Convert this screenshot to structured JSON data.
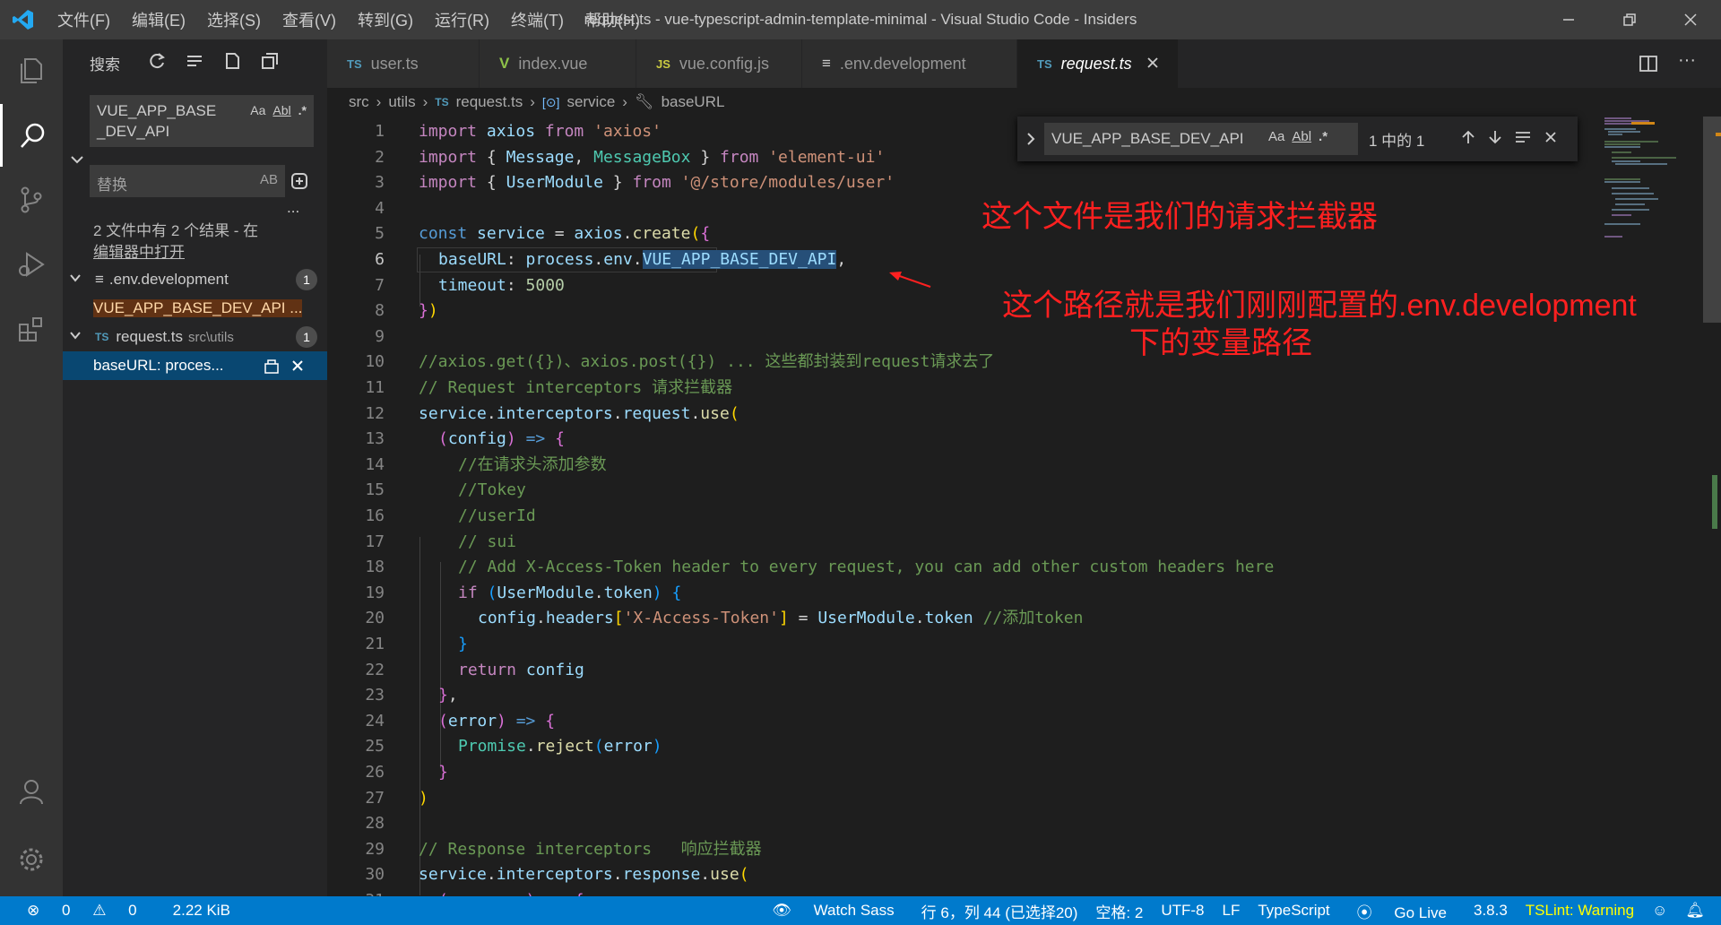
{
  "window": {
    "title": "request.ts - vue-typescript-admin-template-minimal - Visual Studio Code - Insiders",
    "menu": [
      "文件(F)",
      "编辑(E)",
      "选择(S)",
      "查看(V)",
      "转到(G)",
      "运行(R)",
      "终端(T)",
      "帮助(H)"
    ]
  },
  "sidebar": {
    "header": "搜索",
    "search_value_line1": "VUE_APP_BASE",
    "search_value_line2": "_DEV_API",
    "opt_case": "Aa",
    "opt_word": "Abl",
    "opt_regex": ".*",
    "replace_placeholder": "替换",
    "replace_all": "AB",
    "more": "...",
    "result_summary_line1": "2 文件中有 2 个结果 - 在",
    "result_summary_line2": "编辑器中打开",
    "file1": {
      "name": ".env.development",
      "count": "1",
      "match": "VUE_APP_BASE_DEV_API ..."
    },
    "file2": {
      "tag": "TS",
      "name": "request.ts",
      "path": "src\\utils",
      "count": "1",
      "match": "baseURL: proces..."
    }
  },
  "tabs": [
    {
      "tag": "TS",
      "label": "user.ts"
    },
    {
      "tag": "V",
      "label": "index.vue"
    },
    {
      "tag": "JS",
      "label": "vue.config.js"
    },
    {
      "tag": "≡",
      "label": ".env.development"
    },
    {
      "tag": "TS",
      "label": "request.ts"
    }
  ],
  "breadcrumb": [
    "src",
    "utils",
    "TS",
    "request.ts",
    "service",
    "baseURL"
  ],
  "find_widget": {
    "value": "VUE_APP_BASE_DEV_API",
    "opt_case": "Aa",
    "opt_word": "Abl",
    "opt_regex": ".*",
    "result": "1 中的 1"
  },
  "annotations": {
    "a1": "这个文件是我们的请求拦截器",
    "a2_line1": "这个路径就是我们刚刚配置的.env.development",
    "a2_line2": "下的变量路径"
  },
  "code": {
    "l1_a": "import",
    "l1_b": "axios",
    "l1_c": "from",
    "l1_d": "'axios'",
    "l2_a": "import",
    "l2_b": "{",
    "l2_c": "Message",
    "l2_d": "MessageBox",
    "l2_e": "}",
    "l2_f": "from",
    "l2_g": "'element-ui'",
    "l3_a": "import",
    "l3_b": "{",
    "l3_c": "UserModule",
    "l3_d": "}",
    "l3_e": "from",
    "l3_f": "'@/store/modules/user'",
    "l5_a": "const",
    "l5_b": "service",
    "l5_c": "axios",
    "l5_d": "create",
    "l6_a": "baseURL",
    "l6_b": "process",
    "l6_c": "env",
    "l6_d": "VUE_APP_BASE_DEV_API",
    "l7_a": "timeout",
    "l7_b": "5000",
    "l10": "//axios.get({})、axios.post({}) ... 这些都封装到request请求去了",
    "l11": "// Request interceptors 请求拦截器",
    "l12_a": "service",
    "l12_b": "interceptors",
    "l12_c": "request",
    "l12_d": "use",
    "l13": "config",
    "l14": "//在请求头添加参数",
    "l15": "//Tokey",
    "l16": "//userId",
    "l17": "// sui",
    "l18": "// Add X-Access-Token header to every request, you can add other custom headers here",
    "l19_a": "if",
    "l19_b": "UserModule",
    "l19_c": "token",
    "l20_a": "config",
    "l20_b": "headers",
    "l20_c": "'X-Access-Token'",
    "l20_d": "UserModule",
    "l20_e": "token",
    "l20_f": "//添加token",
    "l22_a": "return",
    "l22_b": "config",
    "l24": "error",
    "l25_a": "Promise",
    "l25_b": "reject",
    "l25_c": "error",
    "l29": "// Response interceptors   响应拦截器",
    "l30_a": "service",
    "l30_b": "interceptors",
    "l30_c": "response",
    "l30_d": "use",
    "l31": "response"
  },
  "line_numbers": [
    "1",
    "2",
    "3",
    "4",
    "5",
    "6",
    "7",
    "8",
    "9",
    "10",
    "11",
    "12",
    "13",
    "14",
    "15",
    "16",
    "17",
    "18",
    "19",
    "20",
    "21",
    "22",
    "23",
    "24",
    "25",
    "26",
    "27",
    "28",
    "29",
    "30",
    "31"
  ],
  "statusbar": {
    "errors": "0",
    "warnings": "0",
    "size": "2.22 KiB",
    "watch_sass": "Watch Sass",
    "position": "行 6，列 44 (已选择20)",
    "spaces": "空格: 2",
    "encoding": "UTF-8",
    "eol": "LF",
    "language": "TypeScript",
    "go_live": "Go Live",
    "version": "3.8.3",
    "tslint": "TSLint: Warning"
  }
}
